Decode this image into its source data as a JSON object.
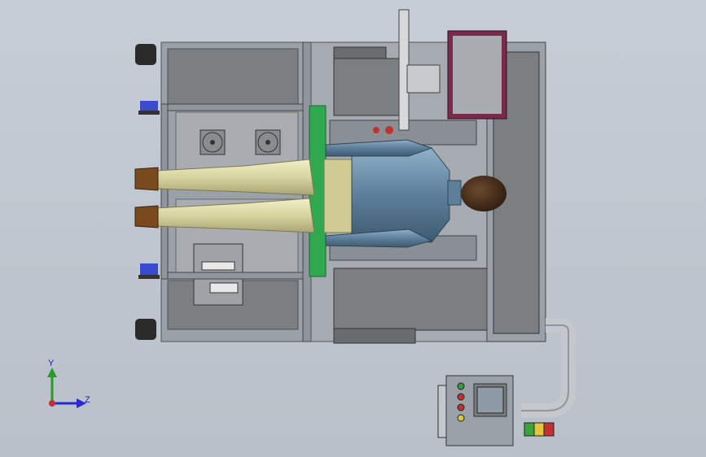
{
  "viewport": {
    "background_top": "#c7cdd6",
    "background_bottom": "#b9c0c9",
    "frame_color": "#8f969e",
    "panel_color": "#7c7f82",
    "board_color": "#2fa84f",
    "suit_color": "#5d7f9a",
    "pants_color": "#d8d4a0",
    "monitor_border": "#7a2a4a"
  },
  "control_box": {
    "screen_color": "#8e9aa4",
    "buttons": [
      {
        "color": "#3a9a3a"
      },
      {
        "color": "#c23030"
      },
      {
        "color": "#c23030"
      },
      {
        "color": "#d8c83a"
      }
    ],
    "tower_colors": [
      "#c23030",
      "#e2c640",
      "#3aa33a"
    ]
  },
  "triad": {
    "y_label": "Y",
    "z_label": "Z",
    "icon": "coordinate-triad-icon"
  }
}
